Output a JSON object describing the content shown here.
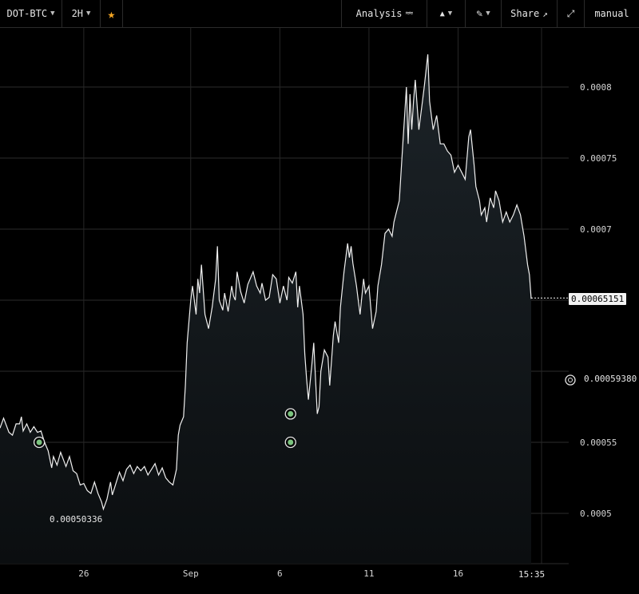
{
  "toolbar": {
    "pair": "DOT-BTC",
    "interval": "2H",
    "analysis": "Analysis",
    "share": "Share",
    "mode": "manual"
  },
  "icons": {
    "favorite": "star-icon",
    "analysis": "indicators-icon",
    "chart_type": "chart-type-icon",
    "draw": "pencil-icon",
    "share": "external-link-icon",
    "fullscreen": "expand-icon"
  },
  "colors": {
    "line": "#f0f0f0",
    "star": "#f5a623",
    "marker": "#7bc47f"
  },
  "labels": {
    "last_price": "0.00065151",
    "marker_price": "0.00059380",
    "low_price": "0.00050336",
    "countdown": "15:35"
  },
  "chart_data": {
    "type": "area",
    "title": "",
    "xlabel": "",
    "ylabel": "",
    "x_ticks": [
      {
        "day": 26,
        "label": "26"
      },
      {
        "day": 32,
        "label": "Sep"
      },
      {
        "day": 37,
        "label": "6"
      },
      {
        "day": 42,
        "label": "11"
      },
      {
        "day": 47,
        "label": "16"
      }
    ],
    "y_ticks": [
      0.0005,
      0.00055,
      0.0007,
      0.00075,
      0.0008
    ],
    "ylim": [
      0.00046,
      0.00083
    ],
    "xlim": [
      21.3,
      51.4
    ],
    "grid": true,
    "series": [
      {
        "values": [
          [
            21.3,
            0.00056
          ],
          [
            21.5,
            0.000567
          ],
          [
            21.8,
            0.000557
          ],
          [
            22.0,
            0.000555
          ],
          [
            22.2,
            0.000563
          ],
          [
            22.4,
            0.000563
          ],
          [
            22.5,
            0.000568
          ],
          [
            22.6,
            0.000558
          ],
          [
            22.8,
            0.000563
          ],
          [
            23.0,
            0.000557
          ],
          [
            23.2,
            0.000561
          ],
          [
            23.4,
            0.000557
          ],
          [
            23.6,
            0.000558
          ],
          [
            23.8,
            0.00055
          ],
          [
            24.0,
            0.000544
          ],
          [
            24.2,
            0.000532
          ],
          [
            24.3,
            0.00054
          ],
          [
            24.5,
            0.000534
          ],
          [
            24.7,
            0.000543
          ],
          [
            25.0,
            0.000533
          ],
          [
            25.2,
            0.00054
          ],
          [
            25.4,
            0.00053
          ],
          [
            25.6,
            0.000528
          ],
          [
            25.8,
            0.00052
          ],
          [
            26.0,
            0.000521
          ],
          [
            26.2,
            0.000516
          ],
          [
            26.4,
            0.000514
          ],
          [
            26.6,
            0.000522
          ],
          [
            26.8,
            0.000514
          ],
          [
            27.0,
            0.000508
          ],
          [
            27.1,
            0.000503
          ],
          [
            27.3,
            0.00051
          ],
          [
            27.5,
            0.000522
          ],
          [
            27.6,
            0.000513
          ],
          [
            27.8,
            0.000521
          ],
          [
            28.0,
            0.000529
          ],
          [
            28.2,
            0.000523
          ],
          [
            28.4,
            0.000531
          ],
          [
            28.6,
            0.000534
          ],
          [
            28.8,
            0.000528
          ],
          [
            29.0,
            0.000533
          ],
          [
            29.2,
            0.00053
          ],
          [
            29.4,
            0.000533
          ],
          [
            29.6,
            0.000527
          ],
          [
            29.8,
            0.000531
          ],
          [
            30.0,
            0.000535
          ],
          [
            30.2,
            0.000527
          ],
          [
            30.4,
            0.000532
          ],
          [
            30.6,
            0.000525
          ],
          [
            30.8,
            0.000522
          ],
          [
            31.0,
            0.00052
          ],
          [
            31.2,
            0.000531
          ],
          [
            31.3,
            0.000555
          ],
          [
            31.4,
            0.000562
          ],
          [
            31.6,
            0.000568
          ],
          [
            31.7,
            0.00059
          ],
          [
            31.8,
            0.00062
          ],
          [
            32.0,
            0.00065
          ],
          [
            32.1,
            0.00066
          ],
          [
            32.3,
            0.00064
          ],
          [
            32.4,
            0.000665
          ],
          [
            32.5,
            0.000655
          ],
          [
            32.6,
            0.000675
          ],
          [
            32.8,
            0.00064
          ],
          [
            33.0,
            0.00063
          ],
          [
            33.2,
            0.000645
          ],
          [
            33.4,
            0.000665
          ],
          [
            33.5,
            0.000688
          ],
          [
            33.6,
            0.00065
          ],
          [
            33.8,
            0.000643
          ],
          [
            33.9,
            0.000655
          ],
          [
            34.1,
            0.000642
          ],
          [
            34.3,
            0.00066
          ],
          [
            34.4,
            0.000653
          ],
          [
            34.5,
            0.00065
          ],
          [
            34.6,
            0.00067
          ],
          [
            34.8,
            0.000656
          ],
          [
            35.0,
            0.000648
          ],
          [
            35.2,
            0.000661
          ],
          [
            35.3,
            0.000664
          ],
          [
            35.5,
            0.00067
          ],
          [
            35.7,
            0.00066
          ],
          [
            35.9,
            0.000655
          ],
          [
            36.0,
            0.000662
          ],
          [
            36.2,
            0.00065
          ],
          [
            36.4,
            0.000652
          ],
          [
            36.6,
            0.000668
          ],
          [
            36.8,
            0.000665
          ],
          [
            37.0,
            0.000648
          ],
          [
            37.2,
            0.00066
          ],
          [
            37.4,
            0.00065
          ],
          [
            37.5,
            0.000666
          ],
          [
            37.7,
            0.000662
          ],
          [
            37.9,
            0.00067
          ],
          [
            38.0,
            0.000645
          ],
          [
            38.1,
            0.00066
          ],
          [
            38.3,
            0.00064
          ],
          [
            38.4,
            0.000612
          ],
          [
            38.5,
            0.000595
          ],
          [
            38.6,
            0.00058
          ],
          [
            38.8,
            0.000605
          ],
          [
            38.9,
            0.00062
          ],
          [
            39.1,
            0.00057
          ],
          [
            39.2,
            0.000575
          ],
          [
            39.3,
            0.0006
          ],
          [
            39.5,
            0.000615
          ],
          [
            39.7,
            0.00061
          ],
          [
            39.8,
            0.00059
          ],
          [
            40.0,
            0.000625
          ],
          [
            40.1,
            0.000635
          ],
          [
            40.3,
            0.00062
          ],
          [
            40.4,
            0.000645
          ],
          [
            40.6,
            0.00067
          ],
          [
            40.8,
            0.00069
          ],
          [
            40.9,
            0.00068
          ],
          [
            41.0,
            0.000688
          ],
          [
            41.1,
            0.000676
          ],
          [
            41.3,
            0.00066
          ],
          [
            41.4,
            0.00065
          ],
          [
            41.5,
            0.00064
          ],
          [
            41.7,
            0.000665
          ],
          [
            41.8,
            0.000655
          ],
          [
            42.0,
            0.00066
          ],
          [
            42.2,
            0.00063
          ],
          [
            42.4,
            0.000642
          ],
          [
            42.5,
            0.00066
          ],
          [
            42.7,
            0.000675
          ],
          [
            42.9,
            0.000697
          ],
          [
            43.1,
            0.0007
          ],
          [
            43.3,
            0.000695
          ],
          [
            43.4,
            0.000705
          ],
          [
            43.5,
            0.00071
          ],
          [
            43.7,
            0.00072
          ],
          [
            43.9,
            0.00076
          ],
          [
            44.0,
            0.00078
          ],
          [
            44.1,
            0.0008
          ],
          [
            44.2,
            0.00076
          ],
          [
            44.3,
            0.000795
          ],
          [
            44.4,
            0.00077
          ],
          [
            44.5,
            0.00079
          ],
          [
            44.6,
            0.000805
          ],
          [
            44.8,
            0.00077
          ],
          [
            45.0,
            0.00079
          ],
          [
            45.1,
            0.0008
          ],
          [
            45.3,
            0.000823
          ],
          [
            45.4,
            0.00079
          ],
          [
            45.6,
            0.00077
          ],
          [
            45.8,
            0.00078
          ],
          [
            46.0,
            0.00076
          ],
          [
            46.2,
            0.00076
          ],
          [
            46.4,
            0.000755
          ],
          [
            46.6,
            0.000752
          ],
          [
            46.8,
            0.00074
          ],
          [
            47.0,
            0.000745
          ],
          [
            47.2,
            0.00074
          ],
          [
            47.4,
            0.000735
          ],
          [
            47.6,
            0.000765
          ],
          [
            47.7,
            0.00077
          ],
          [
            47.9,
            0.000745
          ],
          [
            48.0,
            0.00073
          ],
          [
            48.2,
            0.00072
          ],
          [
            48.3,
            0.00071
          ],
          [
            48.5,
            0.000715
          ],
          [
            48.6,
            0.000705
          ],
          [
            48.8,
            0.000722
          ],
          [
            49.0,
            0.000715
          ],
          [
            49.1,
            0.000727
          ],
          [
            49.3,
            0.00072
          ],
          [
            49.5,
            0.000705
          ],
          [
            49.7,
            0.000712
          ],
          [
            49.9,
            0.000705
          ],
          [
            50.1,
            0.00071
          ],
          [
            50.3,
            0.000717
          ],
          [
            50.5,
            0.00071
          ],
          [
            50.7,
            0.000695
          ],
          [
            50.8,
            0.000685
          ],
          [
            50.9,
            0.000675
          ],
          [
            51.0,
            0.000668
          ],
          [
            51.1,
            0.000651
          ]
        ]
      }
    ],
    "markers": [
      {
        "x": 23.5,
        "y": 0.00055
      },
      {
        "x": 37.6,
        "y": 0.00057
      },
      {
        "x": 37.6,
        "y": 0.00055
      }
    ],
    "last_value": 0.00065151,
    "reference_value": 0.0005938,
    "low_value": 0.00050336
  }
}
